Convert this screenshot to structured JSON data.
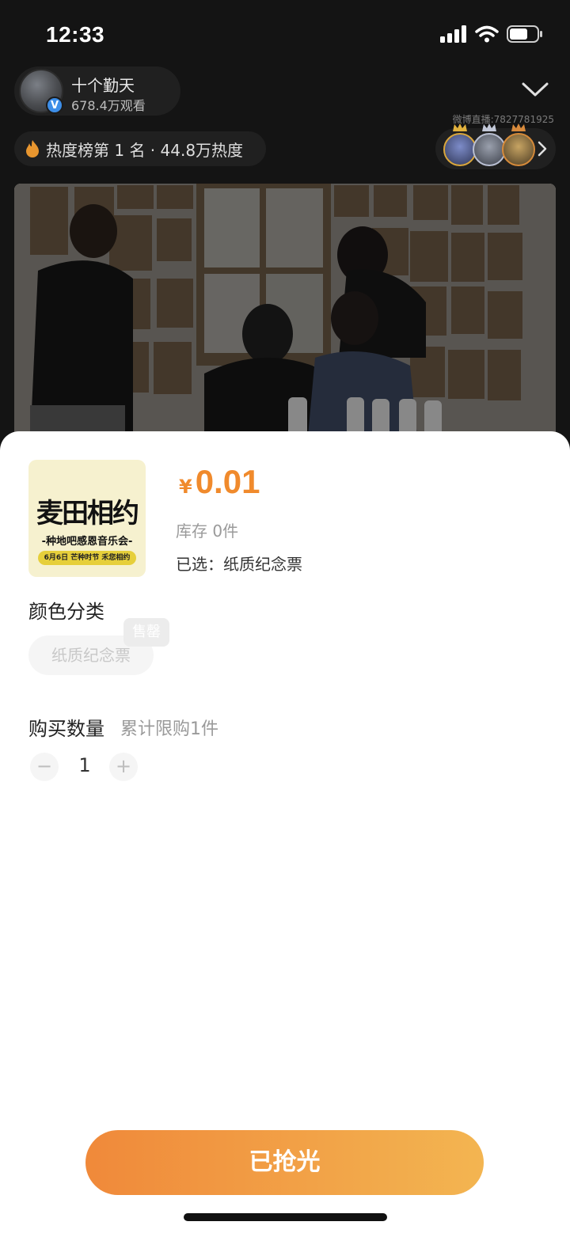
{
  "status_bar": {
    "time": "12:33"
  },
  "live": {
    "host_name": "十个勤天",
    "host_views": "678.4万观看",
    "watermark": "微博直播:7827781925",
    "hot_rank": "热度榜第 1 名 · 44.8万热度"
  },
  "product": {
    "image_title": "麦田相约",
    "image_subtitle": "-种地吧感恩音乐会-",
    "image_tag": "6月6日 芒种时节 禾您相约",
    "price_symbol": "¥",
    "price": "0.01",
    "stock": "库存 0件",
    "selected": "已选：纸质纪念票"
  },
  "variant": {
    "section_label": "颜色分类",
    "option_label": "纸质纪念票",
    "soldout_badge": "售罄"
  },
  "quantity": {
    "section_label": "购买数量",
    "limit_text": "累计限购1件",
    "minus": "−",
    "value": "1",
    "plus": "+"
  },
  "action": {
    "buy_label": "已抢光"
  },
  "colors": {
    "accent": "#f08a2c",
    "button_start": "#f0893a",
    "button_end": "#f3b551"
  }
}
